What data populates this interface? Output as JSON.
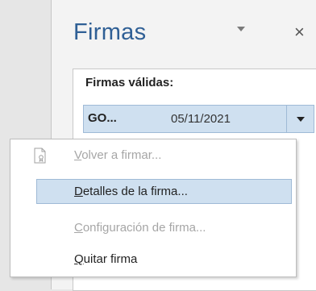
{
  "pane": {
    "title": "Firmas",
    "dropdown_icon": "chevron-down-icon",
    "close_glyph": "×"
  },
  "signatures": {
    "header": "Firmas válidas:",
    "rows": [
      {
        "name": "GO...",
        "date": "05/11/2021"
      }
    ]
  },
  "context_menu": {
    "items": [
      {
        "first": "V",
        "rest": "olver a firmar...",
        "enabled": false,
        "icon": "re-sign-document-icon"
      },
      {
        "first": "D",
        "rest": "etalles de la firma...",
        "enabled": true,
        "highlighted": true
      },
      {
        "first": "C",
        "rest": "onfiguración de firma...",
        "enabled": false
      },
      {
        "first": "Q",
        "rest": "uitar firma",
        "enabled": true
      }
    ]
  },
  "colors": {
    "title_blue": "#2f5f95",
    "selection": "#cfe0f0",
    "selection_border": "#9fbad6",
    "disabled_text": "#a6a6a6"
  }
}
